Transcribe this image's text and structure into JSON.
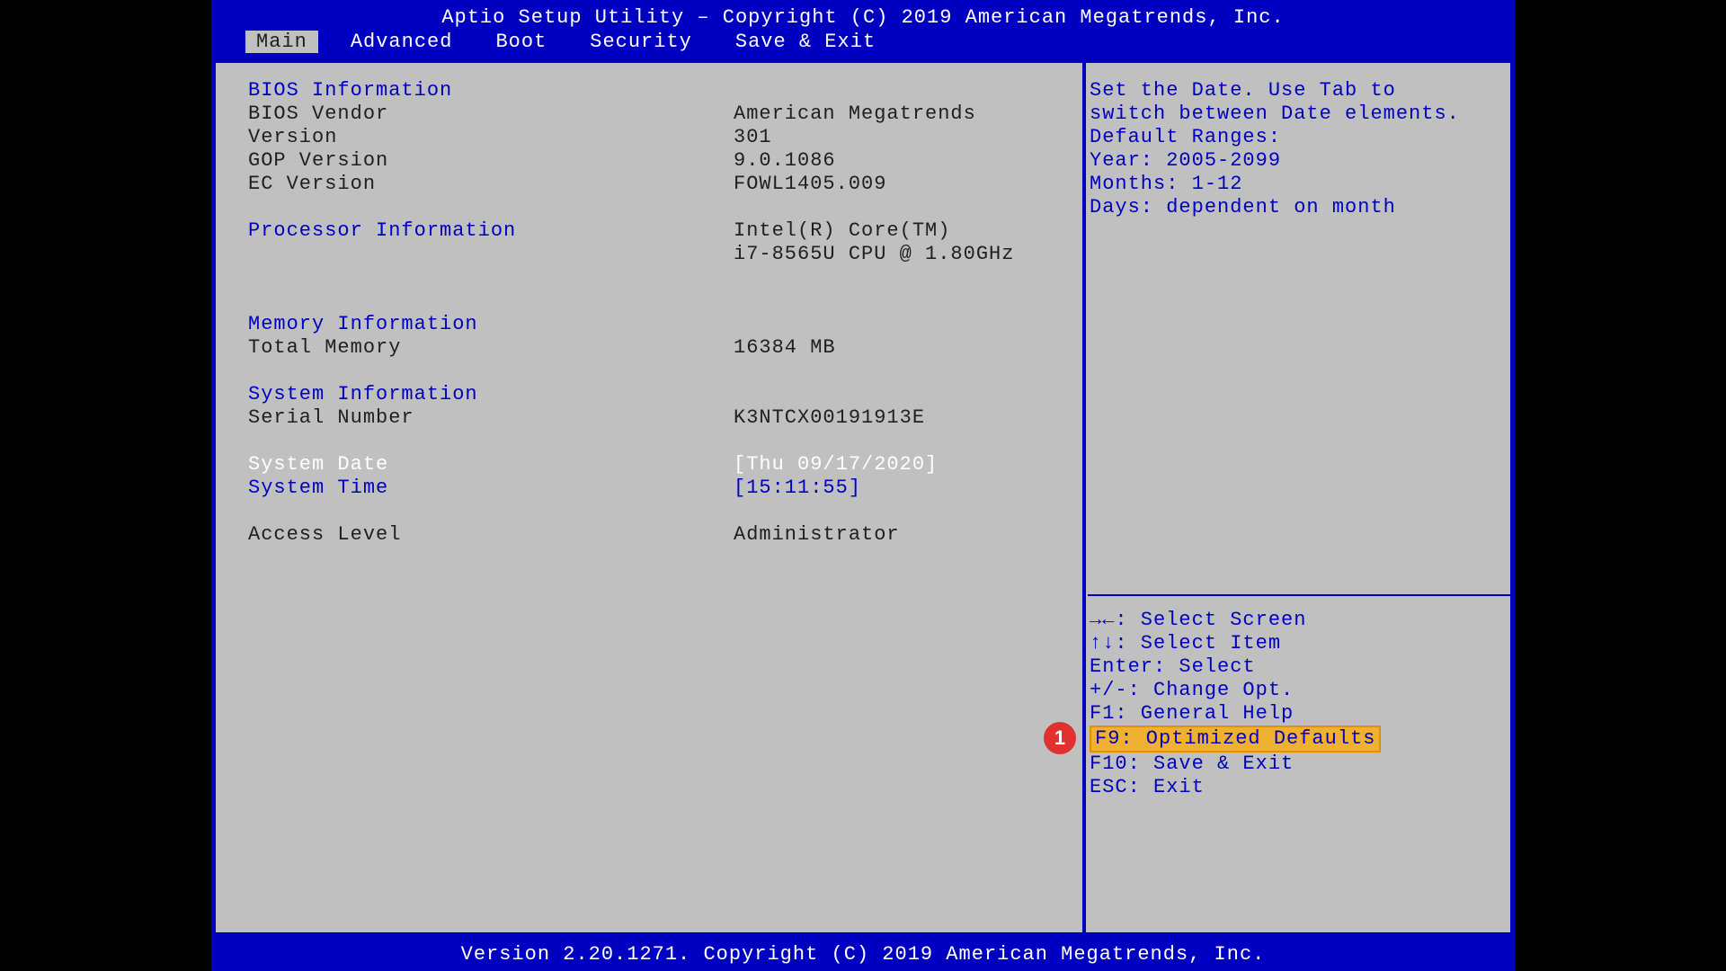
{
  "header": {
    "title": "Aptio Setup Utility – Copyright (C) 2019 American Megatrends, Inc."
  },
  "menu": {
    "tabs": [
      {
        "label": "Main",
        "active": true
      },
      {
        "label": "Advanced",
        "active": false
      },
      {
        "label": "Boot",
        "active": false
      },
      {
        "label": "Security",
        "active": false
      },
      {
        "label": "Save & Exit",
        "active": false
      }
    ]
  },
  "main": {
    "bios_section": "BIOS Information",
    "bios_vendor_label": "BIOS Vendor",
    "bios_vendor_value": "American Megatrends",
    "version_label": "Version",
    "version_value": "301",
    "gop_label": "GOP Version",
    "gop_value": "9.0.1086",
    "ec_label": "EC Version",
    "ec_value": "FOWL1405.009",
    "proc_section": "Processor Information",
    "proc_value_line1": "Intel(R) Core(TM)",
    "proc_value_line2": "i7-8565U CPU @ 1.80GHz",
    "mem_section": "Memory Information",
    "total_mem_label": "Total Memory",
    "total_mem_value": "16384 MB",
    "sys_info_section": "System Information",
    "serial_label": "Serial Number",
    "serial_value": "K3NTCX00191913E",
    "system_date_label": "System Date",
    "system_date_value": "[Thu 09/17/2020]",
    "system_time_label": "System Time",
    "system_time_value": "[15:11:55]",
    "access_label": "Access Level",
    "access_value": "Administrator"
  },
  "help": {
    "line1": "Set the Date. Use Tab to",
    "line2": "switch between Date elements.",
    "line3": "Default Ranges:",
    "line4": "Year: 2005-2099",
    "line5": "Months: 1-12",
    "line6": "Days: dependent on month"
  },
  "keys": {
    "select_screen": "→←: Select Screen",
    "select_item": "↑↓: Select Item",
    "enter": "Enter: Select",
    "change": "+/-: Change Opt.",
    "f1": "F1: General Help",
    "f9": "F9: Optimized Defaults",
    "f10": "F10: Save & Exit",
    "esc": "ESC: Exit"
  },
  "footer": {
    "text": "Version 2.20.1271. Copyright (C) 2019 American Megatrends, Inc."
  },
  "annotation": {
    "badge1": "1"
  }
}
